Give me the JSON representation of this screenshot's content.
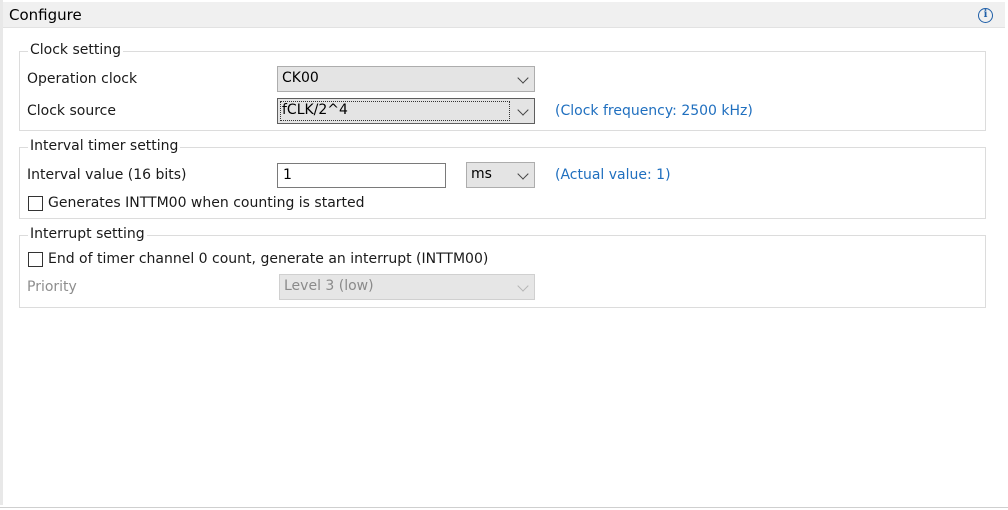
{
  "header": {
    "title": "Configure",
    "info_icon": "info-icon"
  },
  "clock_setting": {
    "legend": "Clock setting",
    "operation_clock_label": "Operation clock",
    "operation_clock_value": "CK00",
    "clock_source_label": "Clock source",
    "clock_source_value": "fCLK/2^4",
    "clock_frequency_note": "(Clock frequency: 2500 kHz)"
  },
  "interval_timer_setting": {
    "legend": "Interval timer setting",
    "interval_value_label": "Interval value (16 bits)",
    "interval_value": "1",
    "unit_value": "ms",
    "actual_value_note": "(Actual value: 1)",
    "generates_checkbox_label": "Generates INTTM00 when counting is started",
    "generates_checked": false
  },
  "interrupt_setting": {
    "legend": "Interrupt setting",
    "end_of_count_checkbox_label": "End of timer channel 0 count, generate an interrupt (INTTM00)",
    "end_of_count_checked": false,
    "priority_label": "Priority",
    "priority_value": "Level 3 (low)"
  },
  "colors": {
    "note_text": "#1f6fbf",
    "header_bg": "#f0f0f0"
  }
}
